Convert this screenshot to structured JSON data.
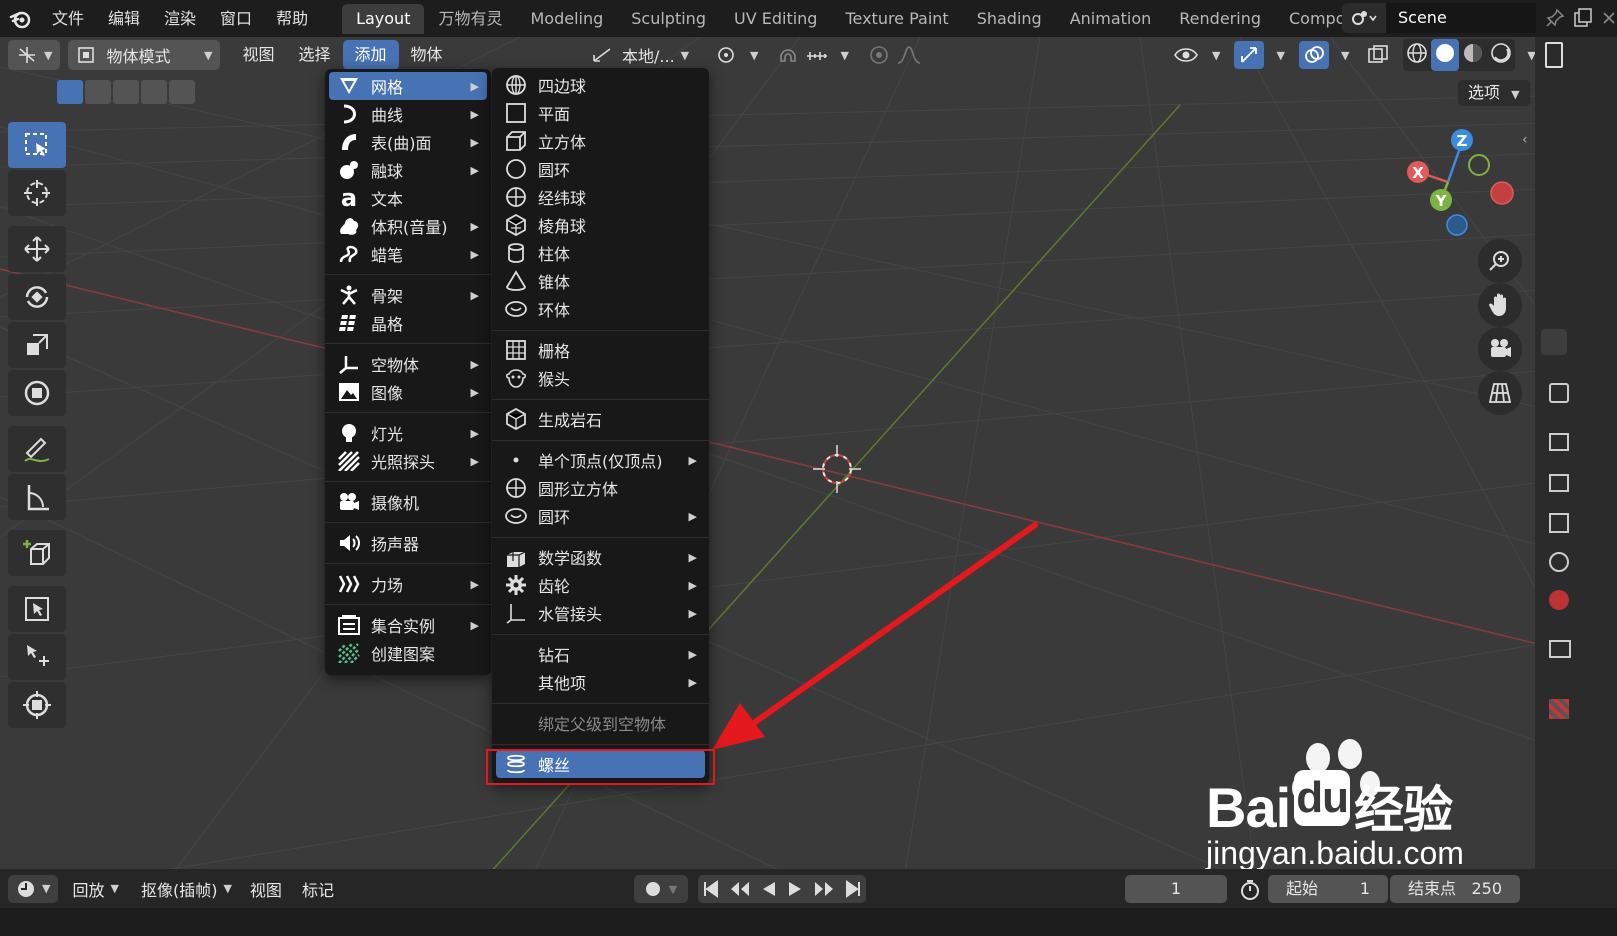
{
  "topbar": {
    "menus": [
      "文件",
      "编辑",
      "渲染",
      "窗口",
      "帮助"
    ],
    "workspace_tabs": [
      "Layout",
      "万物有灵",
      "Modeling",
      "Sculpting",
      "UV Editing",
      "Texture Paint",
      "Shading",
      "Animation",
      "Rendering",
      "Compo"
    ],
    "active_tab": "Layout",
    "scene_name": "Scene"
  },
  "viewport_header": {
    "mode": "物体模式",
    "menus": [
      "视图",
      "选择",
      "添加",
      "物体"
    ],
    "active_menu": "添加",
    "transform_orientation": "本地/...",
    "options_label": "选项"
  },
  "add_menu": {
    "items": [
      {
        "label": "网格",
        "icon": "mesh-icon",
        "submenu": true,
        "highlighted": true
      },
      {
        "label": "曲线",
        "icon": "curve-icon",
        "submenu": true
      },
      {
        "label": "表(曲)面",
        "icon": "surface-icon",
        "submenu": true
      },
      {
        "label": "融球",
        "icon": "metaball-icon",
        "submenu": true
      },
      {
        "label": "文本",
        "icon": "text-icon",
        "submenu": false
      },
      {
        "label": "体积(音量)",
        "icon": "volume-icon",
        "submenu": true
      },
      {
        "label": "蜡笔",
        "icon": "grease-pencil-icon",
        "submenu": true
      },
      {
        "label": "骨架",
        "icon": "armature-icon",
        "submenu": true
      },
      {
        "label": "晶格",
        "icon": "lattice-icon",
        "submenu": false
      },
      {
        "label": "空物体",
        "icon": "empty-icon",
        "submenu": true
      },
      {
        "label": "图像",
        "icon": "image-icon",
        "submenu": true
      },
      {
        "label": "灯光",
        "icon": "light-icon",
        "submenu": true
      },
      {
        "label": "光照探头",
        "icon": "light-probe-icon",
        "submenu": true
      },
      {
        "label": "摄像机",
        "icon": "camera-icon",
        "submenu": false
      },
      {
        "label": "扬声器",
        "icon": "speaker-icon",
        "submenu": false
      },
      {
        "label": "力场",
        "icon": "force-field-icon",
        "submenu": true
      },
      {
        "label": "集合实例",
        "icon": "collection-icon",
        "submenu": true
      },
      {
        "label": "创建图案",
        "icon": "pattern-icon",
        "submenu": false
      }
    ]
  },
  "mesh_menu": {
    "items": [
      {
        "label": "四边球",
        "icon": "quadsphere-icon"
      },
      {
        "label": "平面",
        "icon": "plane-icon"
      },
      {
        "label": "立方体",
        "icon": "cube-icon"
      },
      {
        "label": "圆环",
        "icon": "circle-icon"
      },
      {
        "label": "经纬球",
        "icon": "uv-sphere-icon"
      },
      {
        "label": "棱角球",
        "icon": "ico-sphere-icon"
      },
      {
        "label": "柱体",
        "icon": "cylinder-icon"
      },
      {
        "label": "锥体",
        "icon": "cone-icon"
      },
      {
        "label": "环体",
        "icon": "torus-icon"
      },
      {
        "label": "栅格",
        "icon": "grid-icon"
      },
      {
        "label": "猴头",
        "icon": "monkey-icon"
      },
      {
        "label": "生成岩石",
        "icon": "rock-icon"
      },
      {
        "label": "单个顶点(仅顶点)",
        "icon": "vertex-icon",
        "submenu": true
      },
      {
        "label": "圆形立方体",
        "icon": "round-cube-icon"
      },
      {
        "label": "圆环",
        "icon": "torus-icon",
        "submenu": true
      },
      {
        "label": "数学函数",
        "icon": "math-function-icon",
        "submenu": true
      },
      {
        "label": "齿轮",
        "icon": "gear-icon",
        "submenu": true
      },
      {
        "label": "水管接头",
        "icon": "pipe-joint-icon",
        "submenu": true
      },
      {
        "label": "钻石",
        "icon": "",
        "submenu": true
      },
      {
        "label": "其他项",
        "icon": "",
        "submenu": true
      },
      {
        "label": "绑定父级到空物体",
        "icon": "",
        "disabled": true
      },
      {
        "label": "螺丝",
        "icon": "screw-icon",
        "highlighted": true
      }
    ]
  },
  "gizmo": {
    "x": "X",
    "y": "Y",
    "z": "Z"
  },
  "timeline": {
    "playback": "回放",
    "keying": "抠像(插帧)",
    "view": "视图",
    "marker": "标记",
    "current_frame": "1",
    "start_label": "起始",
    "start_value": "1",
    "end_label": "结束点",
    "end_value": "250"
  },
  "watermark": {
    "brand": "Bai",
    "brand_cn": "经验",
    "url": "jingyan.baidu.com"
  },
  "colors": {
    "accent": "#4772b3",
    "menu_bg": "#181818",
    "annotation_red": "#e3191e",
    "axis_x": "#e05a5a",
    "axis_y": "#7cb342",
    "axis_z": "#3d8ce0"
  }
}
